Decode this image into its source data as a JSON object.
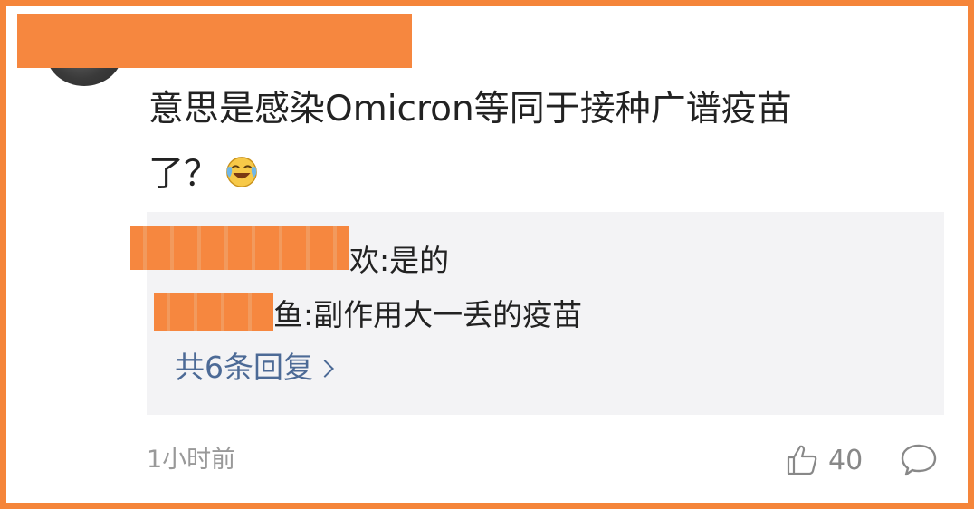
{
  "comment": {
    "text_line1": "意思是感染Omicron等同于接种广谱疫苗",
    "text_line2": "了？",
    "emoji": "laughing-crying-emoji"
  },
  "replies": [
    {
      "author_visible_suffix": "欢",
      "text": ":是的"
    },
    {
      "author_visible_suffix": "鱼",
      "text": ":副作用大一丢的疫苗"
    }
  ],
  "more_replies_label": "共6条回复",
  "timestamp": "1小时前",
  "like_count": "40",
  "colors": {
    "frame": "#f5853a",
    "link": "#4c6a96",
    "reply_bg": "#f3f3f5"
  }
}
